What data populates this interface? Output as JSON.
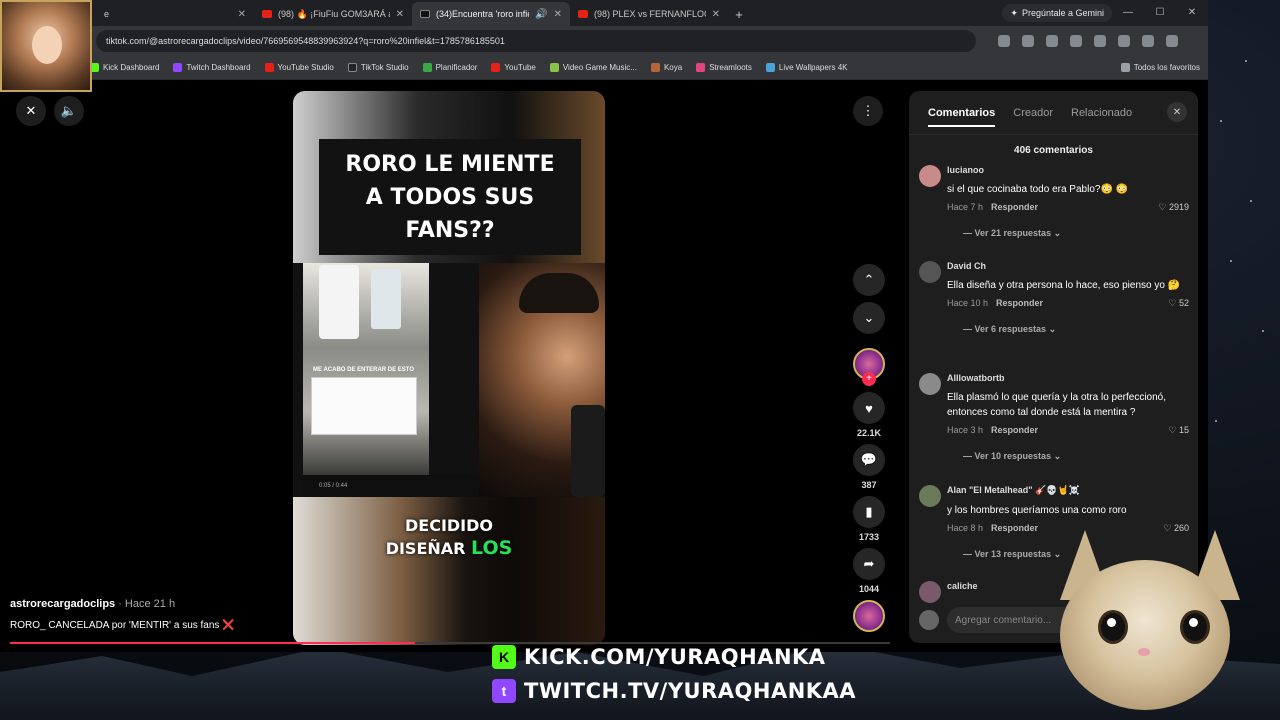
{
  "browser": {
    "tabs": [
      {
        "label": "e",
        "active": false
      },
      {
        "label": "(98) 🔥 ¡FiuFiu GOM3ARÁ a Si...",
        "active": false
      },
      {
        "label": "(34)Encuentra 'roro infiel' e",
        "active": true
      },
      {
        "label": "(98) PLEX vs FERNANFLOO | LA...",
        "active": false
      }
    ],
    "gemini_label": "Pregúntale a Gemini",
    "url": "tiktok.com/@astrorecargadoclips/video/7669569548839963924?q=roro%20infiel&t=1785786185501",
    "bookmarks": [
      "Kick Dashboard",
      "Twitch Dashboard",
      "YouTube Studio",
      "TikTok Studio",
      "Planificador",
      "YouTube",
      "Video Game Music...",
      "Koya",
      "Streamloots",
      "Live Wallpapers 4K"
    ],
    "bookmarks_all": "Todos los favoritos"
  },
  "video": {
    "title_lines": [
      "RORO LE MIENTE",
      "A TODOS SUS",
      "FANS??"
    ],
    "caption_line1": "DECIDIDO",
    "caption_line2a": "DISEÑAR ",
    "caption_line2b": "LOS",
    "inner_caption": "ME ACABO DE ENTERAR DE ESTO",
    "inner_time": "0:05 / 0:44",
    "author": "astrorecargadoclips",
    "author_time": " · Hace 21 h",
    "description": "RORO_ CANCELADA por 'MENTIR' a sus fans ",
    "description_emoji": "❌",
    "progress_pct": 46
  },
  "actions": {
    "likes": "22.1K",
    "comments": "387",
    "saves": "1733",
    "shares": "1044"
  },
  "panel": {
    "tabs": [
      "Comentarios",
      "Creador",
      "Relacionado"
    ],
    "count_label": "406 comentarios",
    "reply_label": "Responder",
    "comments": [
      {
        "user": "lucianoo",
        "text": "si el que cocinaba todo era Pablo?😳 😳",
        "time": "Hace 7 h",
        "likes": "2919",
        "more": "Ver 21 respuestas"
      },
      {
        "user": "David Ch",
        "text": "Ella diseña y otra persona lo hace, eso pienso yo 🤔",
        "time": "Hace 10 h",
        "likes": "52",
        "more": "Ver 6 respuestas"
      },
      {
        "user": "Alllowatbortb",
        "text": "Ella plasmó lo que quería y la otra lo perfeccionó, entonces como tal donde está la mentira ?",
        "time": "Hace 3 h",
        "likes": "15",
        "more": "Ver 10 respuestas"
      },
      {
        "user": "Alan \"El Metalhead\" 🎸💀🤘☠️",
        "text": "y los hombres queríamos una como roro",
        "time": "Hace 8 h",
        "likes": "260",
        "more": "Ver 13 respuestas"
      },
      {
        "user": "caliche",
        "text": "",
        "time": "",
        "likes": "",
        "more": ""
      }
    ],
    "input_placeholder": "Agregar comentario..."
  },
  "stream": {
    "kick": "KICK.COM/YURAQHANKA",
    "twitch": "TWITCH.TV/YURAQHANKAA"
  },
  "colors": {
    "kick": "#53fc18",
    "twitch": "#9146ff",
    "tiktok_red": "#fe2c55",
    "caption_green": "#27e05a"
  }
}
